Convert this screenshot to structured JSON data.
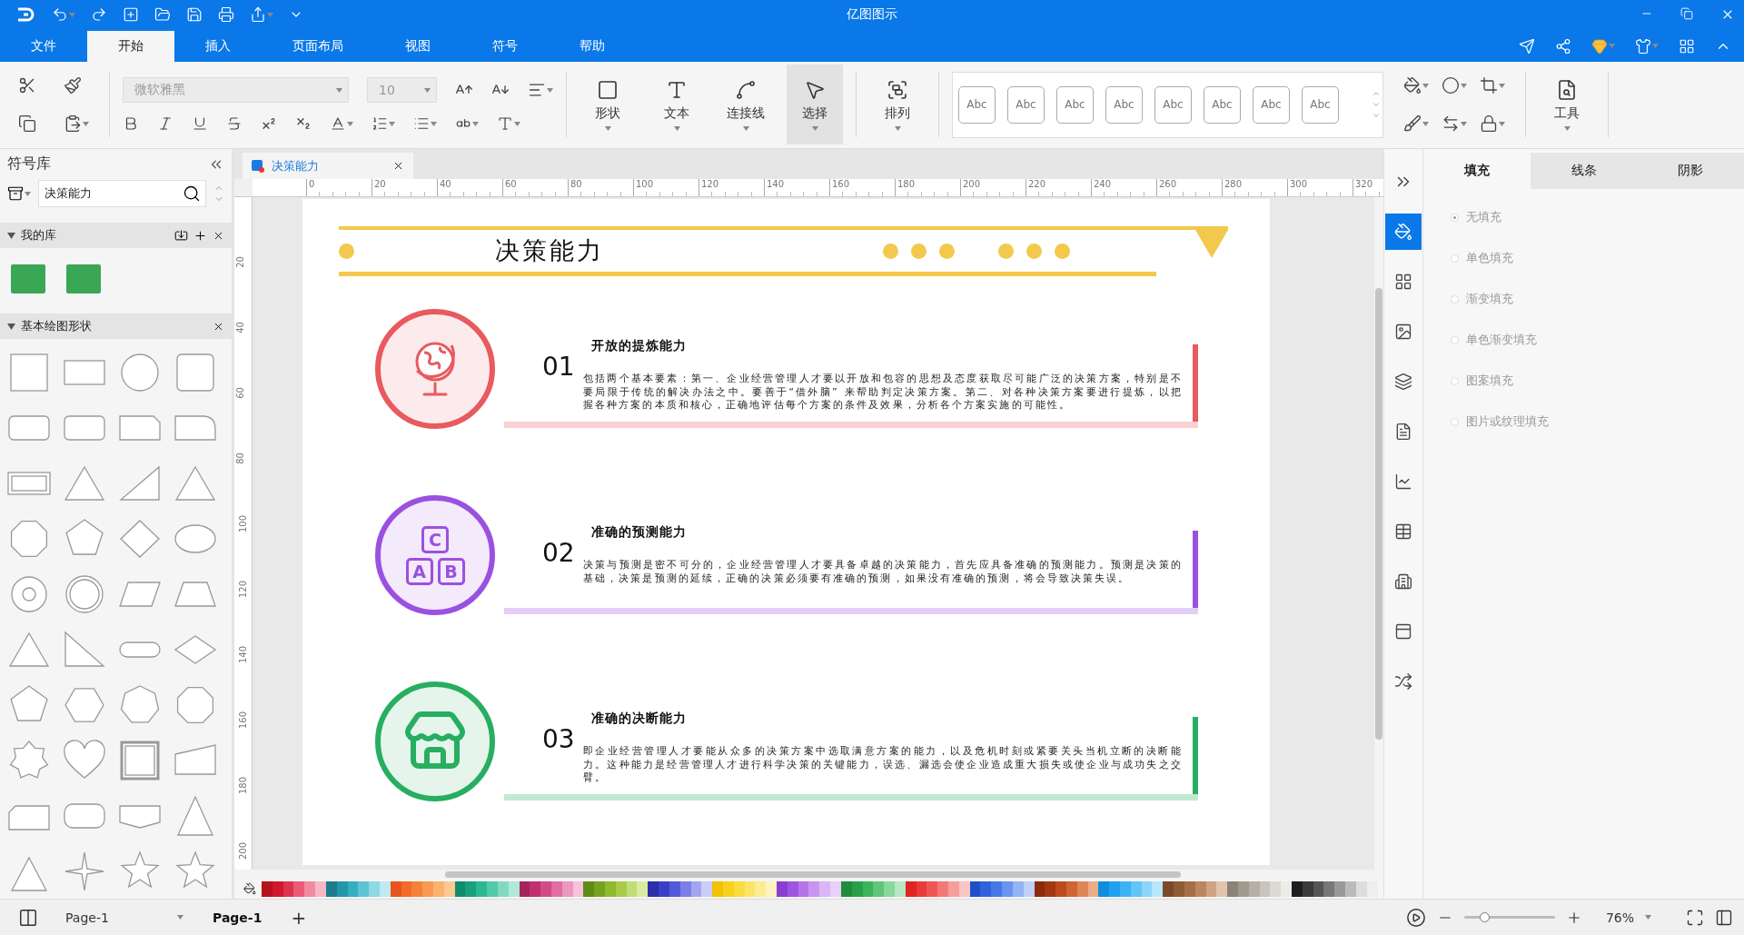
{
  "app": {
    "title": "亿图图示"
  },
  "menu_tabs": [
    {
      "label": "文件",
      "selected": false
    },
    {
      "label": "开始",
      "selected": true
    },
    {
      "label": "插入",
      "selected": false
    },
    {
      "label": "页面布局",
      "selected": false
    },
    {
      "label": "视图",
      "selected": false
    },
    {
      "label": "符号",
      "selected": false
    },
    {
      "label": "帮助",
      "selected": false
    }
  ],
  "toolbar": {
    "font": "微软雅黑",
    "font_size": "10",
    "tools": [
      {
        "label": "形状",
        "selected": false
      },
      {
        "label": "文本",
        "selected": false
      },
      {
        "label": "连接线",
        "selected": false
      },
      {
        "label": "选择",
        "selected": true
      }
    ],
    "arrange": "排列",
    "style_swatches": [
      "Abc",
      "Abc",
      "Abc",
      "Abc",
      "Abc",
      "Abc",
      "Abc",
      "Abc"
    ],
    "tools_button": "工具"
  },
  "library": {
    "title": "符号库",
    "search": "决策能力",
    "sections": [
      {
        "title": "我的库",
        "expanded": true
      },
      {
        "title": "基本绘图形状",
        "expanded": true
      }
    ]
  },
  "document_tab": "决策能力",
  "ruler": {
    "x_ticks": [
      "0",
      "20",
      "40",
      "60",
      "80",
      "100",
      "120",
      "140",
      "160",
      "180",
      "200",
      "220",
      "240",
      "260",
      "280",
      "300",
      "320"
    ],
    "y_ticks": [
      "20",
      "40",
      "60",
      "80",
      "100",
      "120",
      "140",
      "160",
      "180",
      "200"
    ]
  },
  "diagram": {
    "title": "决策能力",
    "items": [
      {
        "number": "01",
        "title": "开放的提炼能力",
        "body": "包括两个基本要素：第一、企业经营管理人才要以开放和包容的思想及态度获取尽可能广泛的决策方案，特别是不要局限于传统的解决办法之中。要善于“借外脑” 来帮助判定决策方案。第二、对各种决策方案要进行提炼，以把握各种方案的本质和核心，正确地评估每个方案的条件及效果，分析各个方案实施的可能性。",
        "color": "#e85a5e"
      },
      {
        "number": "02",
        "title": "准确的预测能力",
        "body": "决策与预测是密不可分的，企业经营管理人才要具备卓越的决策能力，首先应具备准确的预测能力。预测是决策的基础，决策是预测的延续，正确的决策必须要有准确的预测，如果没有准确的预测，将会导致决策失误。",
        "color": "#9b51e0",
        "icon_text": [
          "C",
          "A",
          "B"
        ]
      },
      {
        "number": "03",
        "title": "准确的决断能力",
        "body": "即企业经营管理人才要能从众多的决策方案中选取满意方案的能力，以及危机时刻或紧要关头当机立断的决断能力。这种能力是经营管理人才进行科学决策的关键能力，误选、漏选会使企业造成重大损失或使企业与成功失之交臂。",
        "color": "#27ae60"
      }
    ]
  },
  "properties": {
    "tabs": [
      {
        "label": "填充",
        "selected": true
      },
      {
        "label": "线条",
        "selected": false
      },
      {
        "label": "阴影",
        "selected": false
      }
    ],
    "fill_options": [
      {
        "label": "无填充",
        "selected": true
      },
      {
        "label": "单色填充",
        "selected": false
      },
      {
        "label": "渐变填充",
        "selected": false
      },
      {
        "label": "单色渐变填充",
        "selected": false
      },
      {
        "label": "图案填充",
        "selected": false
      },
      {
        "label": "图片或纹理填充",
        "selected": false
      }
    ]
  },
  "palette": [
    {
      "color": "#b5121b"
    },
    {
      "color": "#d0192c"
    },
    {
      "color": "#e0334d"
    },
    {
      "color": "#ec5a78"
    },
    {
      "color": "#f28aa0"
    },
    {
      "color": "#f7b8c6"
    },
    {
      "color": "#1c7c8c"
    },
    {
      "color": "#2596a8"
    },
    {
      "color": "#36adc0"
    },
    {
      "color": "#5cc4d4"
    },
    {
      "color": "#8fd8e4"
    },
    {
      "color": "#bfeaf2"
    },
    {
      "color": "#e8541c"
    },
    {
      "color": "#f26b2a"
    },
    {
      "color": "#f5823b"
    },
    {
      "color": "#f89a52"
    },
    {
      "color": "#fab26f"
    },
    {
      "color": "#fcc994"
    },
    {
      "color": "#0f8c6c"
    },
    {
      "color": "#1aa07e"
    },
    {
      "color": "#2db894"
    },
    {
      "color": "#53c9a8"
    },
    {
      "color": "#82d9c0"
    },
    {
      "color": "#b1e9d8"
    },
    {
      "color": "#a6245c"
    },
    {
      "color": "#c03070"
    },
    {
      "color": "#d24a88"
    },
    {
      "color": "#e06ea2"
    },
    {
      "color": "#eb98bf"
    },
    {
      "color": "#f5c3da"
    },
    {
      "color": "#5e8c16"
    },
    {
      "color": "#76a31f"
    },
    {
      "color": "#8fb92e"
    },
    {
      "color": "#a8cc4a"
    },
    {
      "color": "#c2dd75"
    },
    {
      "color": "#dbeba4"
    },
    {
      "color": "#2b2fa8"
    },
    {
      "color": "#3a3fc8"
    },
    {
      "color": "#5459dc"
    },
    {
      "color": "#7b7fe6"
    },
    {
      "color": "#a3a6ef"
    },
    {
      "color": "#cbcdf7"
    },
    {
      "color": "#f2c200"
    },
    {
      "color": "#f7d21a"
    },
    {
      "color": "#fadc3c"
    },
    {
      "color": "#fce466"
    },
    {
      "color": "#fdec92"
    },
    {
      "color": "#fef4bf"
    },
    {
      "color": "#8a3fd0"
    },
    {
      "color": "#a055e0"
    },
    {
      "color": "#b474e8"
    },
    {
      "color": "#c795ef"
    },
    {
      "color": "#d9b6f5"
    },
    {
      "color": "#eacff9"
    },
    {
      "color": "#1e8c3a"
    },
    {
      "color": "#27a047"
    },
    {
      "color": "#3db45c"
    },
    {
      "color": "#5fc67a"
    },
    {
      "color": "#8ad79e"
    },
    {
      "color": "#b6e8c3"
    },
    {
      "color": "#e02424"
    },
    {
      "color": "#ea3b3b"
    },
    {
      "color": "#f05656"
    },
    {
      "color": "#f47878"
    },
    {
      "color": "#f89d9d"
    },
    {
      "color": "#fbc4c4"
    },
    {
      "color": "#1f4fc8"
    },
    {
      "color": "#2f62dc"
    },
    {
      "color": "#4678e8"
    },
    {
      "color": "#6b94ef"
    },
    {
      "color": "#94b3f4"
    },
    {
      "color": "#bfd1f9"
    },
    {
      "color": "#8c2a0c"
    },
    {
      "color": "#a33812"
    },
    {
      "color": "#bd4a1e"
    },
    {
      "color": "#d06434"
    },
    {
      "color": "#de8658"
    },
    {
      "color": "#eaad88"
    },
    {
      "color": "#0f8ee0"
    },
    {
      "color": "#1fa2ee"
    },
    {
      "color": "#3db3f4"
    },
    {
      "color": "#62c4f7"
    },
    {
      "color": "#8ed5fa"
    },
    {
      "color": "#bae6fc"
    },
    {
      "color": "#7a4a2a"
    },
    {
      "color": "#8f5a36"
    },
    {
      "color": "#a66e48"
    },
    {
      "color": "#bb8662"
    },
    {
      "color": "#cfa384"
    },
    {
      "color": "#e2c4ac"
    },
    {
      "color": "#8a8478"
    },
    {
      "color": "#a09a8e"
    },
    {
      "color": "#b5b0a5"
    },
    {
      "color": "#c9c5bc"
    },
    {
      "color": "#dcd9d2"
    },
    {
      "color": "#eeece7"
    },
    {
      "color": "#1e1e1e"
    },
    {
      "color": "#3a3a3a"
    },
    {
      "color": "#555555"
    },
    {
      "color": "#777777"
    },
    {
      "color": "#999999"
    },
    {
      "color": "#bbbbbb"
    },
    {
      "color": "#dddddd"
    },
    {
      "color": "#eeeeee"
    }
  ],
  "status_bar": {
    "page_select": "Page-1",
    "pages": [
      {
        "label": "Page-1",
        "selected": true
      }
    ],
    "add": "+",
    "zoom": {
      "value": "76%",
      "level": 0.23
    }
  }
}
